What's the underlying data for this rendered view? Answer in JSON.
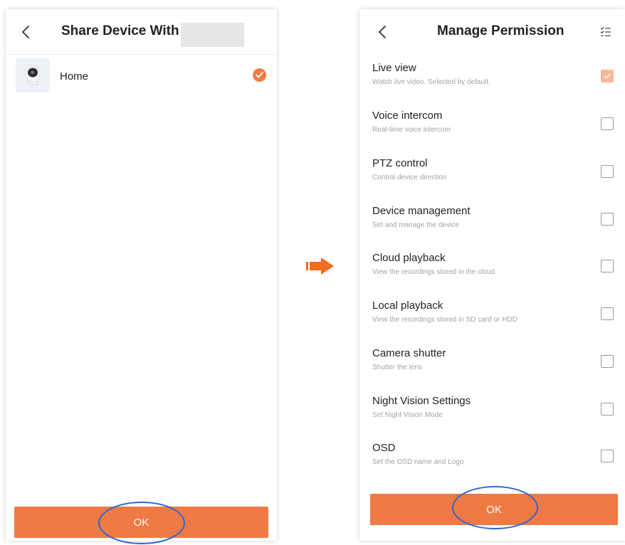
{
  "left_screen": {
    "title": "Share Device With",
    "devices": [
      {
        "name": "Home",
        "selected": true
      }
    ],
    "ok_label": "OK"
  },
  "right_screen": {
    "title": "Manage Permission",
    "permissions": [
      {
        "title": "Live view",
        "description": "Watch live video. Selected by default.",
        "checked": true
      },
      {
        "title": "Voice intercom",
        "description": "Real-time voice intercom",
        "checked": false
      },
      {
        "title": "PTZ control",
        "description": "Control device direction",
        "checked": false
      },
      {
        "title": "Device management",
        "description": "Set and manage the device",
        "checked": false
      },
      {
        "title": "Cloud playback",
        "description": "View the recordings stored in the cloud",
        "checked": false
      },
      {
        "title": "Local playback",
        "description": "View the recordings stored in SD card or HDD",
        "checked": false
      },
      {
        "title": "Camera shutter",
        "description": "Shutter the lens",
        "checked": false
      },
      {
        "title": "Night Vision Settings",
        "description": "Set Night Vision Mode",
        "checked": false
      },
      {
        "title": "OSD",
        "description": "Set the OSD name and Logo",
        "checked": false
      }
    ],
    "ok_label": "OK"
  },
  "colors": {
    "accent": "#ef7a44",
    "annotation": "#2e66d4",
    "checked_disabled": "#f6b99a"
  },
  "icons": [
    "back-chevron-icon",
    "camera-icon",
    "check-icon",
    "list-check-icon",
    "right-arrow-icon"
  ]
}
